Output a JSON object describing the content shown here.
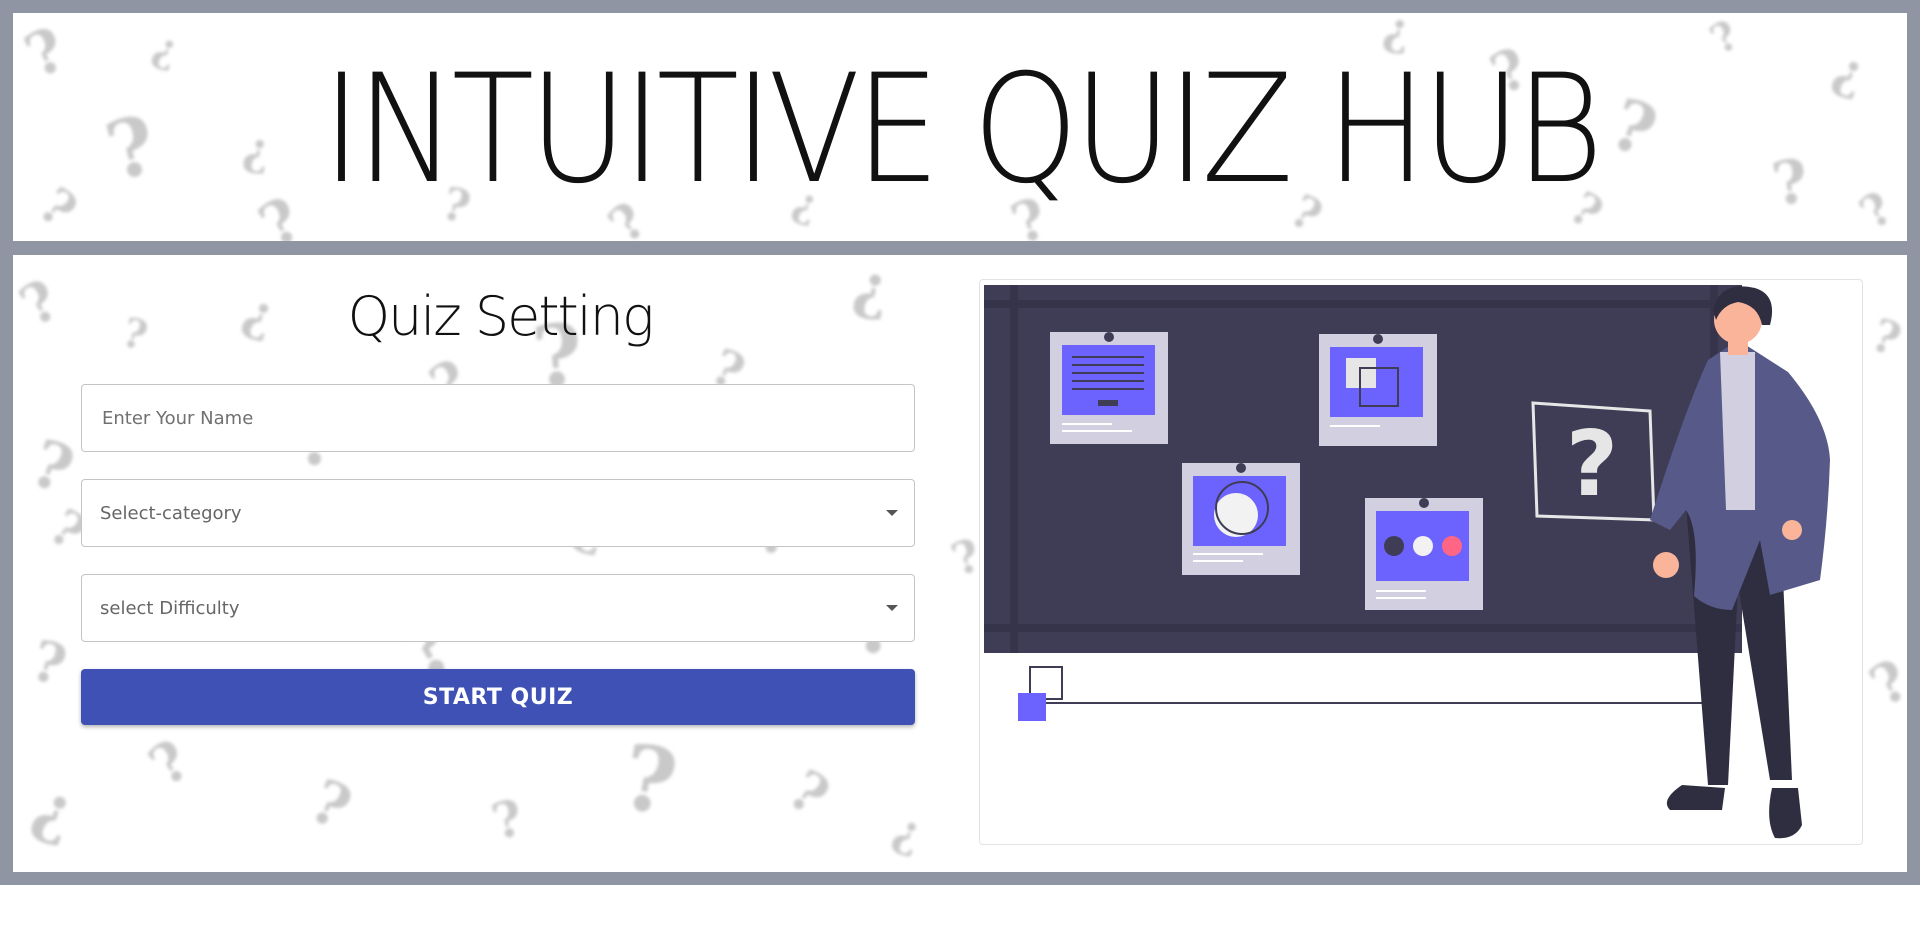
{
  "header": {
    "title": "INTUITIVE QUIZ HUB"
  },
  "settings": {
    "title": "Quiz Setting",
    "name_input": {
      "placeholder": "Enter Your Name",
      "value": ""
    },
    "category_select": {
      "selected": "Select-category"
    },
    "difficulty_select": {
      "selected": "select Difficulty"
    },
    "start_button_label": "START QUIZ"
  },
  "illustration": {
    "question_mark": "?"
  },
  "colors": {
    "frame": "#8f95a3",
    "primary_button": "#3f51b5",
    "board": "#3f3d56",
    "accent_purple": "#6c63ff",
    "accent_red": "#ff6584"
  }
}
